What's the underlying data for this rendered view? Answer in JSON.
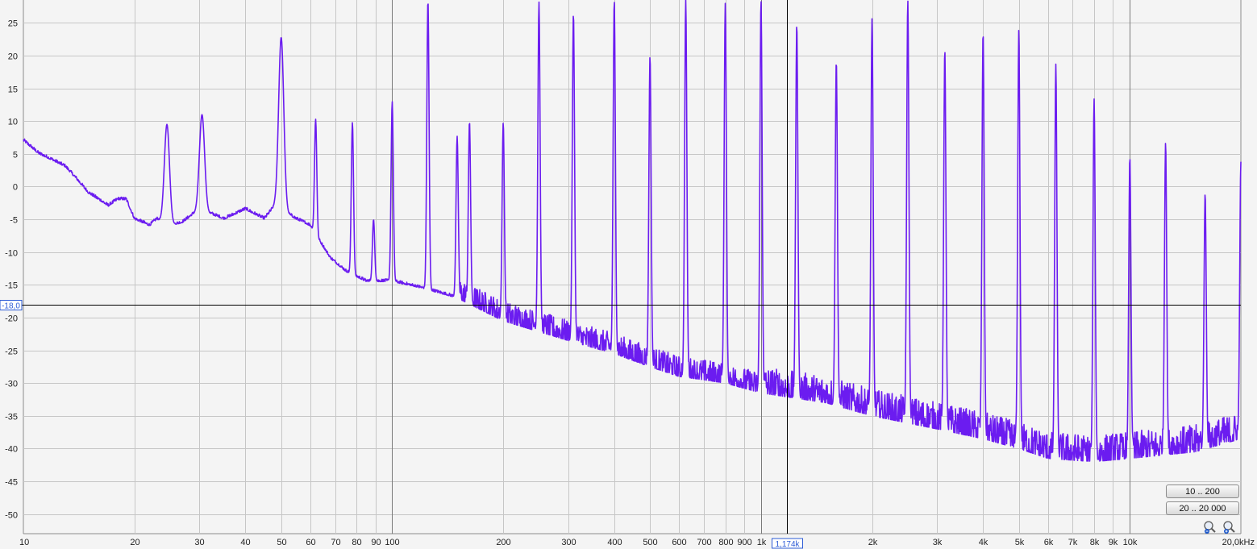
{
  "chart_data": {
    "type": "line",
    "title": "",
    "xlabel": "",
    "ylabel": "",
    "x_scale": "log",
    "xlim": [
      10,
      20000
    ],
    "ylim": [
      -53,
      28.5
    ],
    "grid": true,
    "x_ticks": [
      {
        "value": 10,
        "label": "10"
      },
      {
        "value": 20,
        "label": "20"
      },
      {
        "value": 30,
        "label": "30"
      },
      {
        "value": 40,
        "label": "40"
      },
      {
        "value": 50,
        "label": "50"
      },
      {
        "value": 60,
        "label": "60"
      },
      {
        "value": 70,
        "label": "70"
      },
      {
        "value": 80,
        "label": "80"
      },
      {
        "value": 90,
        "label": "90"
      },
      {
        "value": 100,
        "label": "100"
      },
      {
        "value": 200,
        "label": "200"
      },
      {
        "value": 300,
        "label": "300"
      },
      {
        "value": 400,
        "label": "400"
      },
      {
        "value": 500,
        "label": "500"
      },
      {
        "value": 600,
        "label": "600"
      },
      {
        "value": 700,
        "label": "700"
      },
      {
        "value": 800,
        "label": "800"
      },
      {
        "value": 900,
        "label": "900"
      },
      {
        "value": 1000,
        "label": "1k"
      },
      {
        "value": 2000,
        "label": "2k"
      },
      {
        "value": 3000,
        "label": "3k"
      },
      {
        "value": 4000,
        "label": "4k"
      },
      {
        "value": 5000,
        "label": "5k"
      },
      {
        "value": 6000,
        "label": "6k"
      },
      {
        "value": 7000,
        "label": "7k"
      },
      {
        "value": 8000,
        "label": "8k"
      },
      {
        "value": 9000,
        "label": "9k"
      },
      {
        "value": 10000,
        "label": "10k"
      },
      {
        "value": 20000,
        "label": "20,0kHz"
      }
    ],
    "y_ticks": [
      25,
      20,
      15,
      10,
      5,
      0,
      -5,
      -10,
      -15,
      -20,
      -25,
      -30,
      -35,
      -40,
      -45,
      -50
    ],
    "cursor": {
      "x": 1174,
      "x_label": "1,174k",
      "y": -18,
      "y_label": "-18,0"
    },
    "series": [
      {
        "color": "#6b1cf0",
        "floor": [
          [
            10,
            7
          ],
          [
            11,
            5
          ],
          [
            12,
            4
          ],
          [
            13,
            3
          ],
          [
            14,
            1
          ],
          [
            15,
            -1
          ],
          [
            16,
            -2
          ],
          [
            17,
            -3
          ],
          [
            18,
            -2
          ],
          [
            19,
            -2
          ],
          [
            20,
            -5
          ],
          [
            21,
            -5.5
          ],
          [
            22,
            -6
          ],
          [
            23,
            -5
          ],
          [
            25,
            -6
          ],
          [
            27,
            -5.5
          ],
          [
            30,
            -3.5
          ],
          [
            35,
            -5
          ],
          [
            40,
            -3.5
          ],
          [
            45,
            -5
          ],
          [
            48,
            -3
          ],
          [
            55,
            -5
          ],
          [
            60,
            -6
          ],
          [
            63,
            -8
          ],
          [
            68,
            -11
          ],
          [
            75,
            -13
          ],
          [
            85,
            -14.5
          ],
          [
            100,
            -14.5
          ],
          [
            120,
            -15.5
          ],
          [
            150,
            -17
          ],
          [
            200,
            -20.5
          ],
          [
            300,
            -23.5
          ],
          [
            400,
            -25.5
          ],
          [
            500,
            -27.5
          ],
          [
            600,
            -29
          ],
          [
            700,
            -29.5
          ],
          [
            800,
            -30
          ],
          [
            1000,
            -31.5
          ],
          [
            1500,
            -33
          ],
          [
            2000,
            -35
          ],
          [
            3000,
            -37
          ],
          [
            4000,
            -38.5
          ],
          [
            5000,
            -40
          ],
          [
            6000,
            -41.5
          ],
          [
            8000,
            -42
          ],
          [
            10000,
            -41.5
          ],
          [
            15000,
            -40.5
          ],
          [
            20000,
            -38.5
          ]
        ],
        "peaks": [
          [
            24.5,
            9.5
          ],
          [
            30.5,
            11
          ],
          [
            50,
            22.8
          ],
          [
            62,
            10.3
          ],
          [
            78,
            9.8
          ],
          [
            89,
            -5
          ],
          [
            100,
            13
          ],
          [
            125,
            28.5
          ],
          [
            150,
            7.7
          ],
          [
            162,
            10
          ],
          [
            200,
            9.8
          ],
          [
            250,
            28.2
          ],
          [
            310,
            26.5
          ],
          [
            400,
            28.5
          ],
          [
            500,
            20
          ],
          [
            625,
            28.5
          ],
          [
            800,
            28
          ],
          [
            1000,
            28.5
          ],
          [
            1250,
            24.9
          ],
          [
            1600,
            19.3
          ],
          [
            2000,
            25.7
          ],
          [
            2500,
            28.5
          ],
          [
            3150,
            21
          ],
          [
            4000,
            23.7
          ],
          [
            5000,
            24
          ],
          [
            6300,
            18.7
          ],
          [
            8000,
            13.4
          ],
          [
            10000,
            4.6
          ],
          [
            12500,
            6.8
          ],
          [
            16000,
            -1
          ],
          [
            20000,
            3.8
          ]
        ]
      }
    ]
  },
  "controls": {
    "range_low_label": "10 .. 200",
    "range_full_label": "20 .. 20 000"
  }
}
